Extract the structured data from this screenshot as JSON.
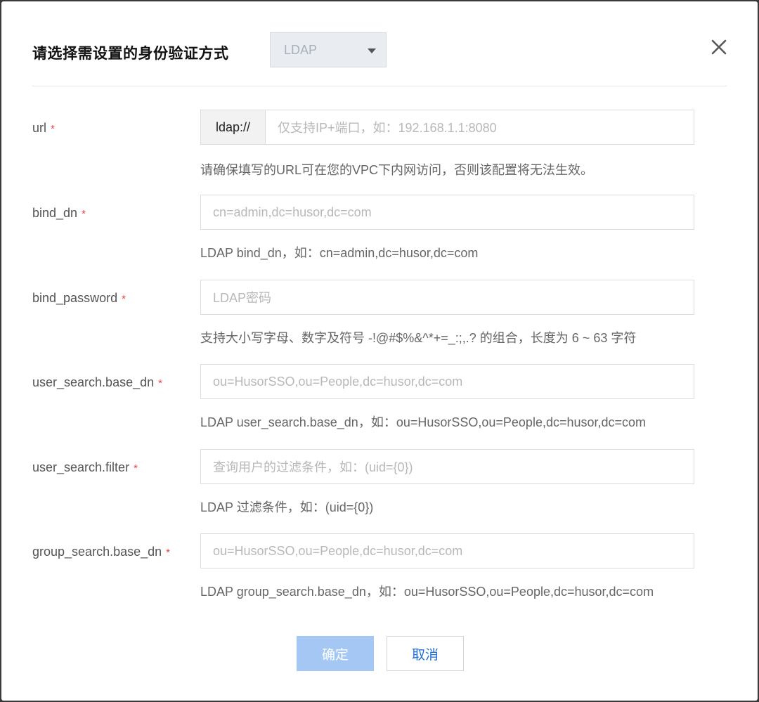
{
  "dialog": {
    "title": "请选择需设置的身份验证方式",
    "auth_type_selected": "LDAP",
    "close_icon": "close-icon"
  },
  "fields": [
    {
      "label": "url",
      "prefix": "ldap://",
      "placeholder": "仅支持IP+端口，如：192.168.1.1:8080",
      "hint": "请确保填写的URL可在您的VPC下内网访问，否则该配置将无法生效。"
    },
    {
      "label": "bind_dn",
      "placeholder": "cn=admin,dc=husor,dc=com",
      "hint": "LDAP bind_dn，如：cn=admin,dc=husor,dc=com"
    },
    {
      "label": "bind_password",
      "placeholder": "LDAP密码",
      "hint": "支持大小写字母、数字及符号 -!@#$%&^*+=_:;,.? 的组合，长度为 6 ~ 63 字符"
    },
    {
      "label": "user_search.base_dn",
      "placeholder": "ou=HusorSSO,ou=People,dc=husor,dc=com",
      "hint": "LDAP user_search.base_dn，如：ou=HusorSSO,ou=People,dc=husor,dc=com"
    },
    {
      "label": "user_search.filter",
      "placeholder": "查询用户的过滤条件，如：(uid={0})",
      "hint": "LDAP 过滤条件，如：(uid={0})"
    },
    {
      "label": "group_search.base_dn",
      "placeholder": "ou=HusorSSO,ou=People,dc=husor,dc=com",
      "hint": "LDAP group_search.base_dn，如：ou=HusorSSO,ou=People,dc=husor,dc=com"
    }
  ],
  "required_mark": "*",
  "buttons": {
    "ok": "确定",
    "cancel": "取消"
  },
  "colors": {
    "required": "#e54545",
    "primary_disabled": "#a4c8f3",
    "link": "#1f6fd8"
  }
}
